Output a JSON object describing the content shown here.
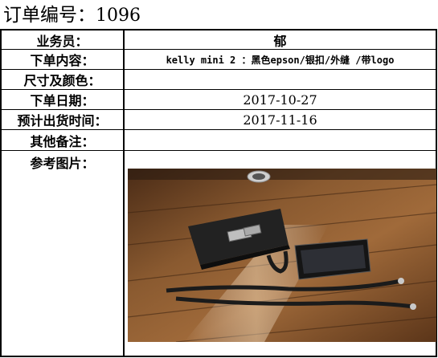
{
  "header": {
    "title_label": "订单编号：",
    "order_number": "1096"
  },
  "fields": [
    {
      "label": "业务员：",
      "value": "郁"
    },
    {
      "label": "下单内容：",
      "value": "kelly mini 2 ：黑色epson/银扣/外缝 /带logo"
    },
    {
      "label": "尺寸及颜色：",
      "value": ""
    },
    {
      "label": "下单日期：",
      "value": "2017-10-27"
    },
    {
      "label": "预计出货时间：",
      "value": "2017-11-16"
    },
    {
      "label": "其他备注：",
      "value": ""
    }
  ],
  "reference": {
    "label": "参考图片：",
    "icon": "product-photo"
  }
}
